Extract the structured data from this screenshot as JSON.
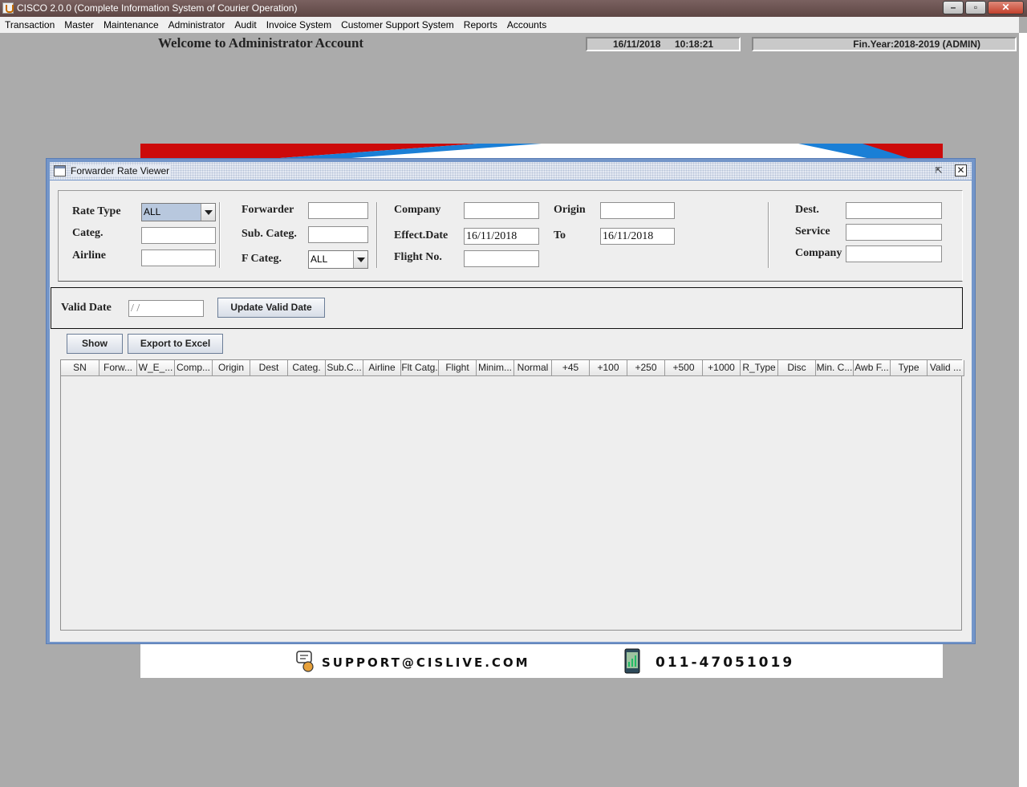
{
  "window": {
    "title": "CISCO 2.0.0 (Complete Information System of Courier Operation)",
    "minimize": "–",
    "maximize": "▫",
    "close": "✕"
  },
  "menu": [
    "Transaction",
    "Master",
    "Maintenance",
    "Administrator",
    "Audit",
    "Invoice System",
    "Customer Support System",
    "Reports",
    "Accounts"
  ],
  "header": {
    "welcome": "Welcome to Administrator Account",
    "date": "16/11/2018",
    "time": "10:18:21",
    "fin_year": "Fin.Year:2018-2019  (ADMIN)"
  },
  "banner": {
    "email": "SUPPORT@CISLIVE.COM",
    "phone": "011-47051019"
  },
  "frame": {
    "title": "Forwarder Rate Viewer",
    "restore": "⇱",
    "close": "✕"
  },
  "filters": {
    "rate_type": {
      "label": "Rate Type",
      "value": "ALL"
    },
    "categ": {
      "label": "Categ.",
      "value": ""
    },
    "airline": {
      "label": "Airline",
      "value": ""
    },
    "forwarder": {
      "label": "Forwarder",
      "value": ""
    },
    "sub_categ": {
      "label": "Sub. Categ.",
      "value": ""
    },
    "f_categ": {
      "label": "F Categ.",
      "value": "ALL"
    },
    "company": {
      "label": "Company",
      "value": ""
    },
    "effect_date": {
      "label": "Effect.Date",
      "value": "16/11/2018"
    },
    "flight_no": {
      "label": "Flight No.",
      "value": ""
    },
    "origin": {
      "label": "Origin",
      "value": ""
    },
    "to": {
      "label": "To",
      "value": "16/11/2018"
    },
    "dest": {
      "label": "Dest.",
      "value": ""
    },
    "service": {
      "label": "Service",
      "value": ""
    },
    "company2": {
      "label": "Company",
      "value": ""
    }
  },
  "valid": {
    "label": "Valid Date",
    "value": " /  /",
    "update_button": "Update Valid Date"
  },
  "buttons": {
    "show": "Show",
    "export": "Export to Excel"
  },
  "table": {
    "columns": [
      "SN",
      "Forw...",
      "W_E_...",
      "Comp...",
      "Origin",
      "Dest",
      "Categ.",
      "Sub.C...",
      "Airline",
      "Flt Catg.",
      "Flight",
      "Minim...",
      "Normal",
      "+45",
      "+100",
      "+250",
      "+500",
      "+1000",
      "R_Type",
      "Disc",
      "Min. C...",
      "Awb F...",
      "Type",
      "Valid ..."
    ],
    "rows": []
  },
  "colors": {
    "desktop": "#ababab",
    "frame_border": "#7496c9",
    "title_bar": "#6b5250",
    "banner_red": "#cc0a0a",
    "banner_blue": "#1a7fd6"
  }
}
